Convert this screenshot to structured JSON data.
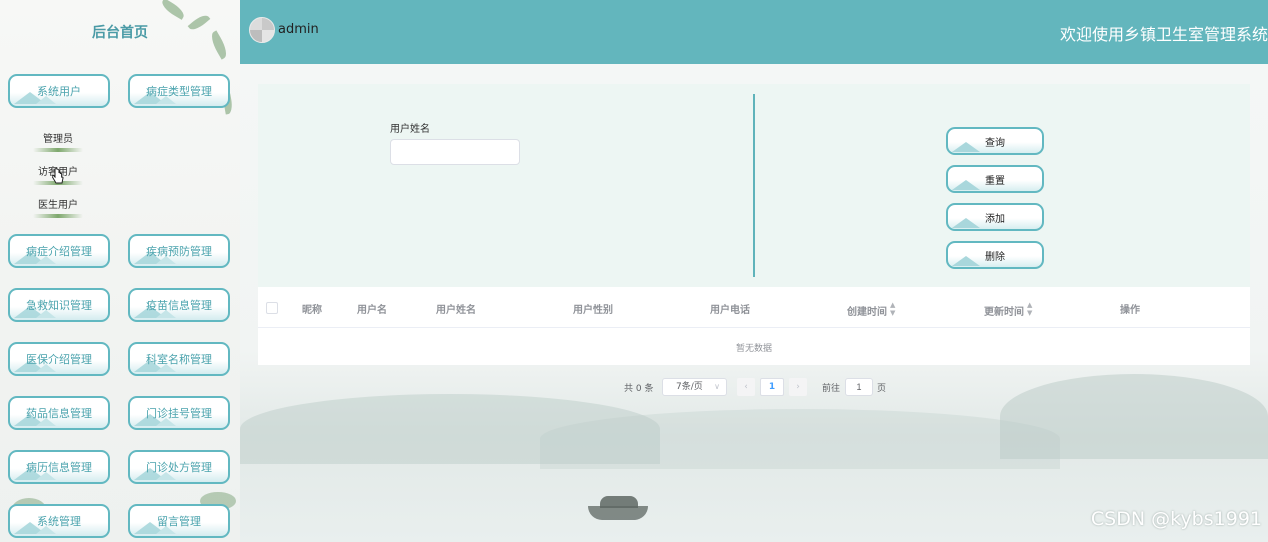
{
  "sidebar": {
    "title": "后台首页",
    "menus": [
      {
        "label": "系统用户"
      },
      {
        "label": "病症类型管理"
      },
      {
        "label": "病症介绍管理"
      },
      {
        "label": "疾病预防管理"
      },
      {
        "label": "急救知识管理"
      },
      {
        "label": "疫苗信息管理"
      },
      {
        "label": "医保介绍管理"
      },
      {
        "label": "科室名称管理"
      },
      {
        "label": "药品信息管理"
      },
      {
        "label": "门诊挂号管理"
      },
      {
        "label": "病历信息管理"
      },
      {
        "label": "门诊处方管理"
      },
      {
        "label": "系统管理"
      },
      {
        "label": "留言管理"
      }
    ],
    "sub_items": [
      {
        "label": "管理员"
      },
      {
        "label": "访客用户"
      },
      {
        "label": "医生用户"
      }
    ]
  },
  "header": {
    "username": "admin",
    "welcome": "欢迎使用乡镇卫生室管理系统"
  },
  "search": {
    "label": "用户姓名",
    "value": "",
    "placeholder": ""
  },
  "actions": {
    "query": "查询",
    "reset": "重置",
    "add": "添加",
    "delete": "删除"
  },
  "table": {
    "columns": [
      "昵称",
      "用户名",
      "用户姓名",
      "用户性别",
      "用户电话",
      "创建时间",
      "更新时间",
      "操作"
    ],
    "sortable": [
      "创建时间",
      "更新时间"
    ],
    "empty_text": "暂无数据"
  },
  "pagination": {
    "total_text": "共 0 条",
    "page_size": "7条/页",
    "current_page": "1",
    "goto_label": "前往",
    "goto_value": "1",
    "goto_unit": "页"
  },
  "watermark": "CSDN @kybs1991",
  "colors": {
    "header": "#63b6bd",
    "accent": "#62b8c1",
    "panel": "#edf6f3"
  }
}
